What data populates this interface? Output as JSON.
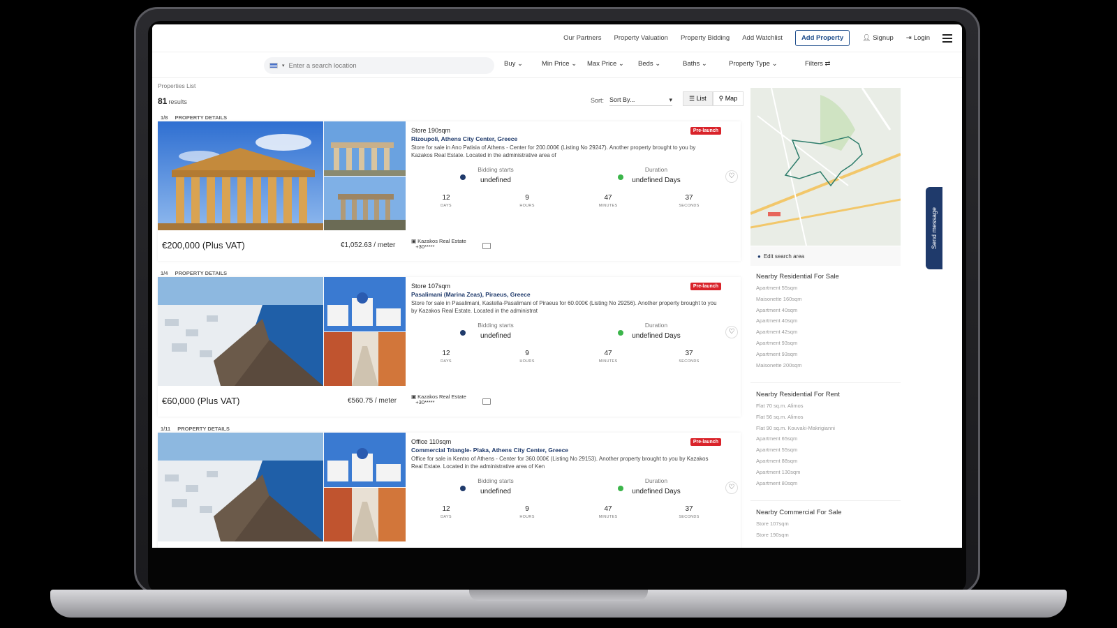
{
  "nav": {
    "links": [
      "Our Partners",
      "Property Valuation",
      "Property Bidding",
      "Add Watchlist"
    ],
    "add_property": "Add Property",
    "signup": "Signup",
    "login": "Login"
  },
  "search": {
    "placeholder": "Enter a search location",
    "filters": [
      "Buy",
      "Min Price",
      "Max Price",
      "Beds",
      "Baths",
      "Property Type",
      "Filters"
    ]
  },
  "breadcrumb": "Properties List",
  "results": {
    "count": "81",
    "label": "results"
  },
  "sort": {
    "label": "Sort:",
    "value": "Sort By..."
  },
  "view": {
    "list": "List",
    "map": "Map"
  },
  "card_common": {
    "details_label": "PROPERTY DETAILS",
    "badge": "Pre-launch",
    "bidding_label": "Bidding starts",
    "bidding_value": "undefined",
    "duration_label": "Duration",
    "duration_value": "undefined Days",
    "timer": [
      {
        "num": "12",
        "unit": "DAYS"
      },
      {
        "num": "9",
        "unit": "HOURS"
      },
      {
        "num": "47",
        "unit": "MINUTES"
      },
      {
        "num": "37",
        "unit": "SECONDS"
      }
    ],
    "agent_name": "Kazakos Real Estate",
    "agent_phone": "+30*****"
  },
  "cards": [
    {
      "photo_count": "1/8",
      "type": "Store 190sqm",
      "address": "Rizoupoli, Athens City Center, Greece",
      "desc": "Store for sale in Ano Patisia of Athens - Center for 200.000€ (Listing No 29247). Another property brought to you by Kazakos Real Estate. Located in the administrative area of",
      "price": "€200,000 (Plus VAT)",
      "ppm": "€1,052.63 / meter"
    },
    {
      "photo_count": "1/4",
      "type": "Store 107sqm",
      "address": "Pasalimani (Marina Zeas), Piraeus, Greece",
      "desc": "Store for sale in Pasalimani, Kastella-Pasalimani of Piraeus for 60.000€ (Listing No 29256). Another property brought to you by Kazakos Real Estate. Located in the administrat",
      "price": "€60,000 (Plus VAT)",
      "ppm": "€560.75 / meter"
    },
    {
      "photo_count": "1/11",
      "type": "Office 110sqm",
      "address": "Commercial Triangle- Plaka, Athens City Center, Greece",
      "desc": "Office for sale in Kentro of Athens - Center for 360.000€ (Listing No 29153). Another property brought to you by Kazakos Real Estate. Located in the administrative area of Ken",
      "price": "",
      "ppm": ""
    }
  ],
  "map": {
    "edit_label": "Edit search area"
  },
  "nearby": [
    {
      "title": "Nearby Residential For Sale",
      "items": [
        "Apartment 55sqm",
        "Maisonette 160sqm",
        "Apartment 40sqm",
        "Apartment 40sqm",
        "Apartment 42sqm",
        "Apartment 93sqm",
        "Apartment 93sqm",
        "Maisonette 200sqm"
      ]
    },
    {
      "title": "Nearby Residential For Rent",
      "items": [
        "Flat 70 sq.m. Alimos",
        "Flat 56 sq.m. Alimos",
        "Flat 90 sq.m. Kouvaki-Makrigianni",
        "Apartment 65sqm",
        "Apartment 55sqm",
        "Apartment 88sqm",
        "Apartment 130sqm",
        "Apartment 80sqm"
      ]
    },
    {
      "title": "Nearby Commercial For Sale",
      "items": [
        "Store 107sqm",
        "Store 190sqm"
      ]
    }
  ],
  "send_message": "Send message"
}
